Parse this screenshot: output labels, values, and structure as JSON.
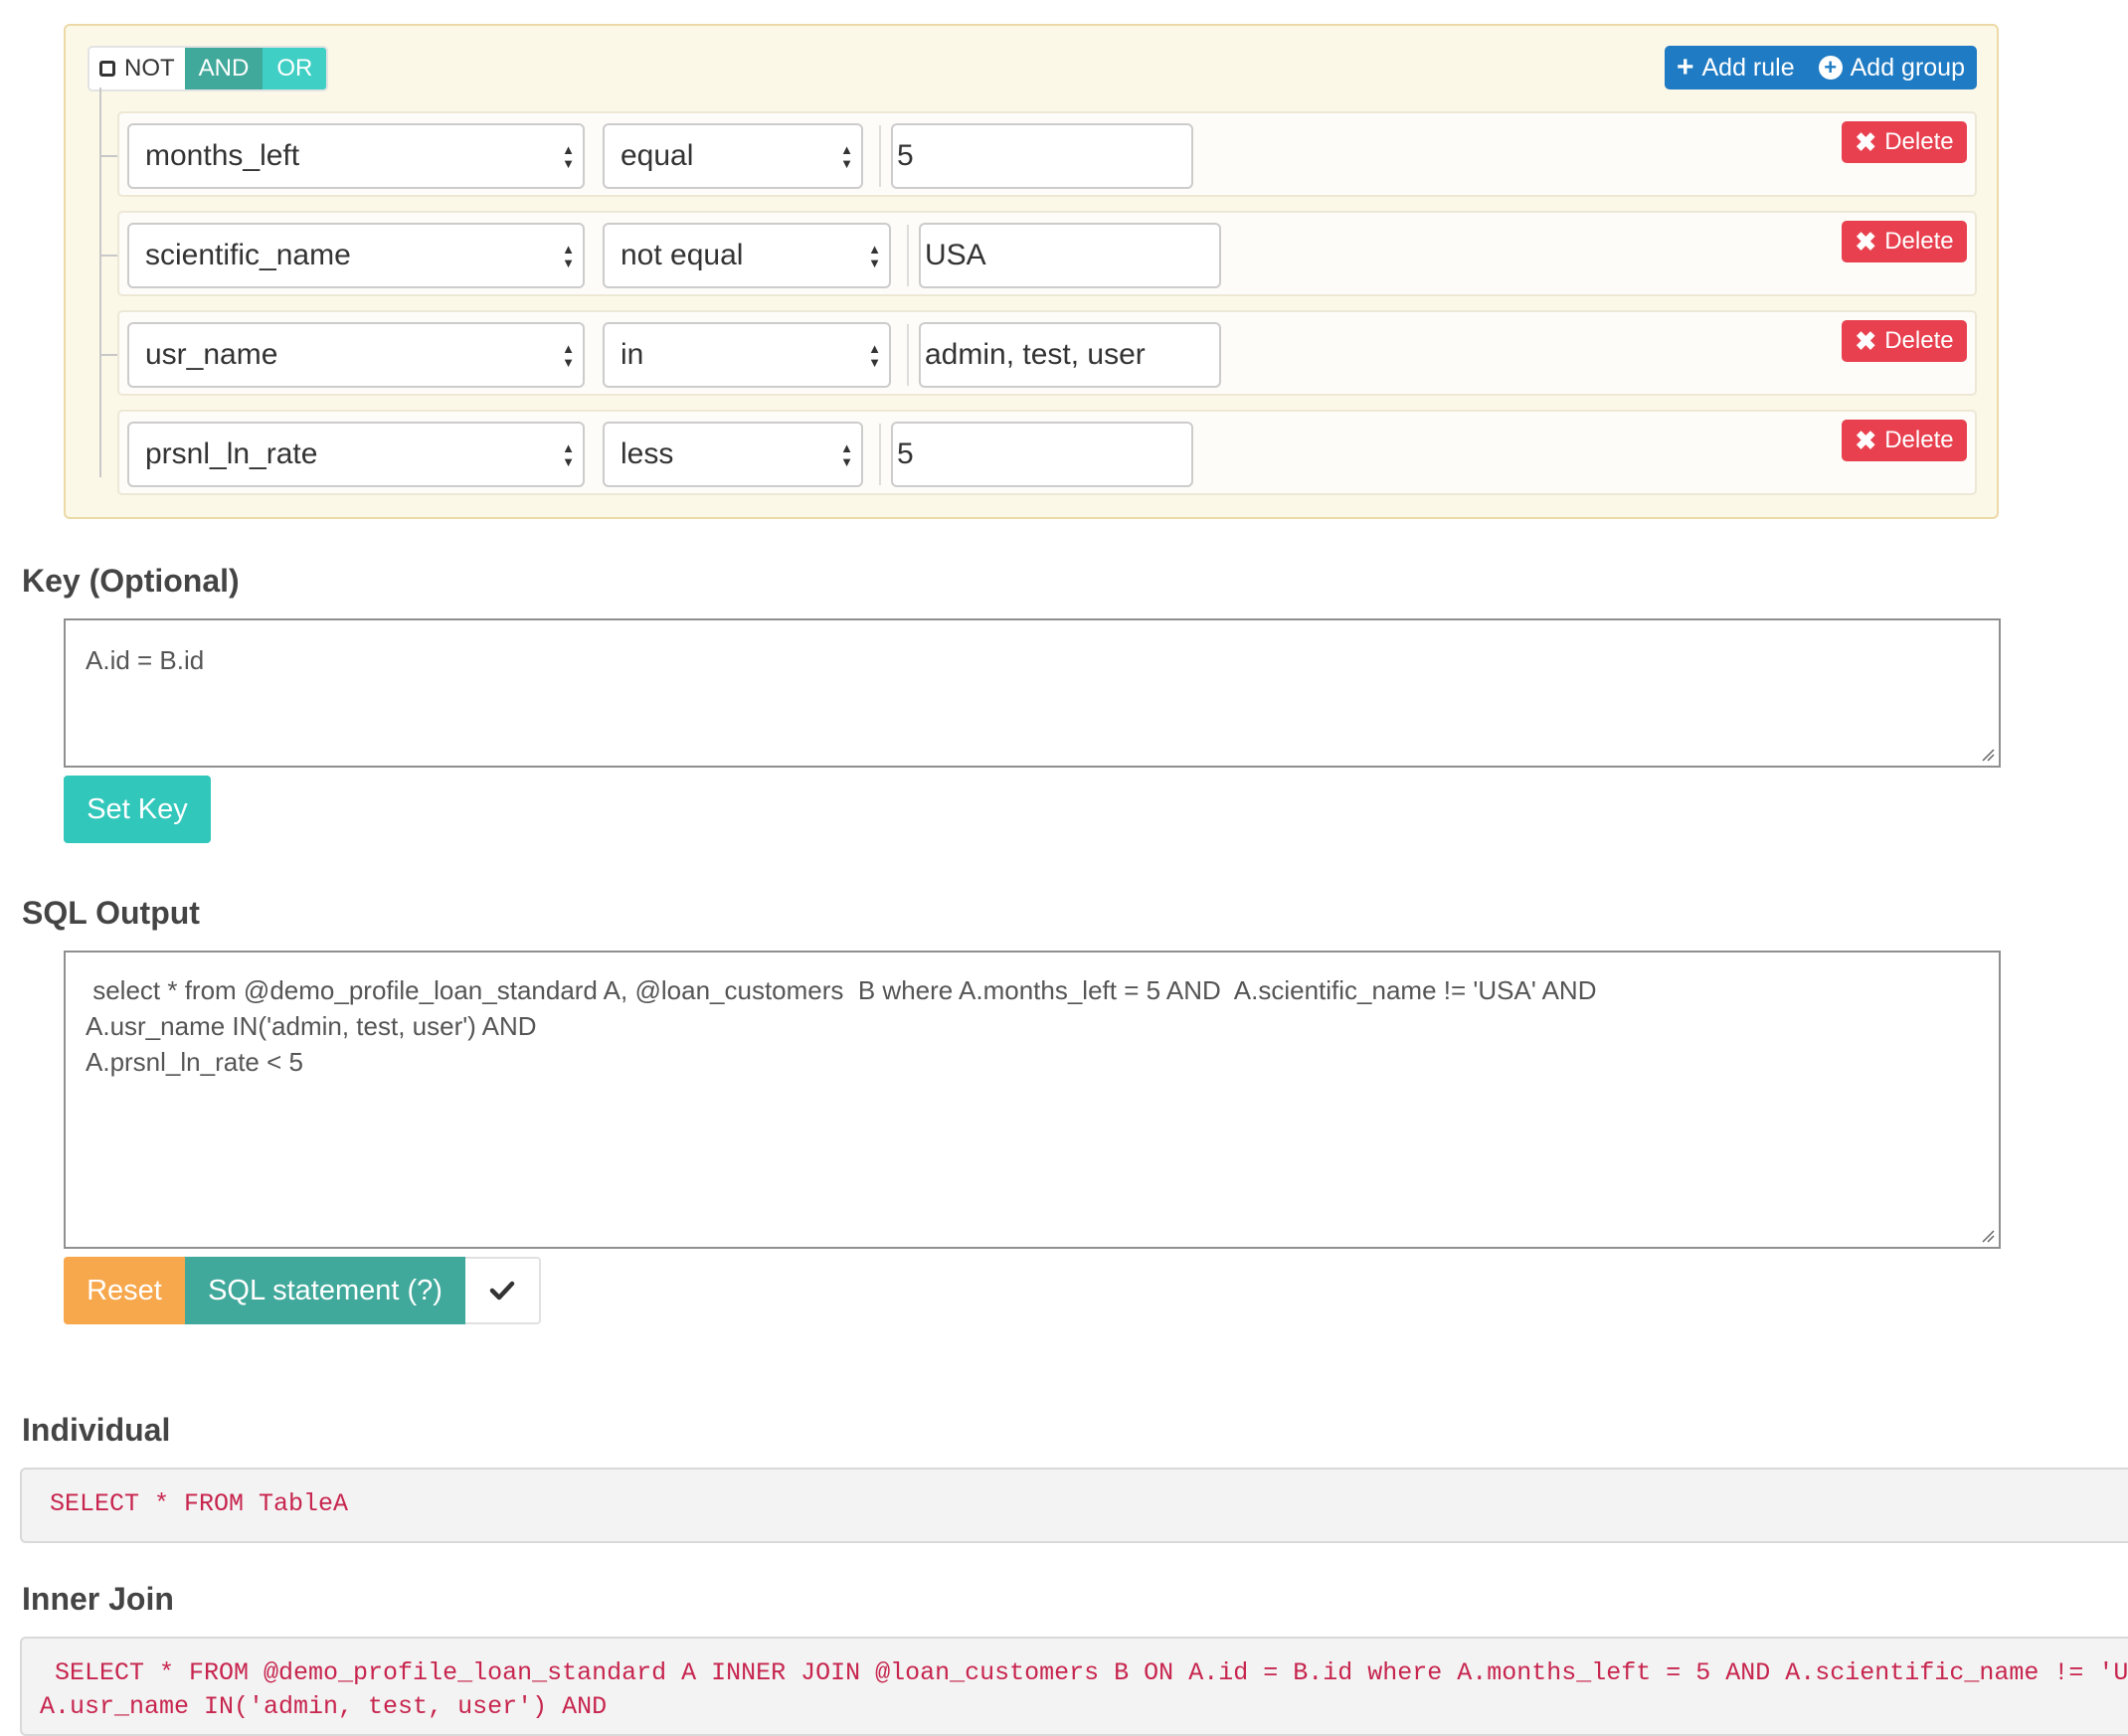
{
  "query_builder": {
    "conditions": {
      "not_label": "NOT",
      "and_label": "AND",
      "or_label": "OR",
      "selected": "AND"
    },
    "add_rule_label": "Add rule",
    "add_group_label": "Add group",
    "rules": [
      {
        "field": "months_left",
        "operator": "equal",
        "value": "5",
        "delete_label": "Delete"
      },
      {
        "field": "scientific_name",
        "operator": "not equal",
        "value": "USA",
        "delete_label": "Delete"
      },
      {
        "field": "usr_name",
        "operator": "in",
        "value": "admin, test, user",
        "delete_label": "Delete"
      },
      {
        "field": "prsnl_ln_rate",
        "operator": "less",
        "value": "5",
        "delete_label": "Delete"
      }
    ]
  },
  "key_section": {
    "title": "Key (Optional)",
    "value": "A.id = B.id",
    "button_label": "Set Key"
  },
  "sql_output": {
    "title": "SQL Output",
    "lines": [
      " select * from @demo_profile_loan_standard A, @loan_customers  B where A.months_left = 5 AND  A.scientific_name != 'USA' AND",
      "A.usr_name IN('admin, test, user') AND",
      "A.prsnl_ln_rate < 5"
    ],
    "reset_label": "Reset",
    "statement_label": "SQL statement (?)"
  },
  "individual": {
    "title": "Individual",
    "code": "SELECT * FROM TableA"
  },
  "inner_join": {
    "title": "Inner Join",
    "lines": [
      " SELECT * FROM @demo_profile_loan_standard A INNER JOIN @loan_customers B ON A.id = B.id where A.months_left = 5 AND A.scientific_name != 'USA' AND",
      "A.usr_name IN('admin, test, user') AND"
    ]
  }
}
